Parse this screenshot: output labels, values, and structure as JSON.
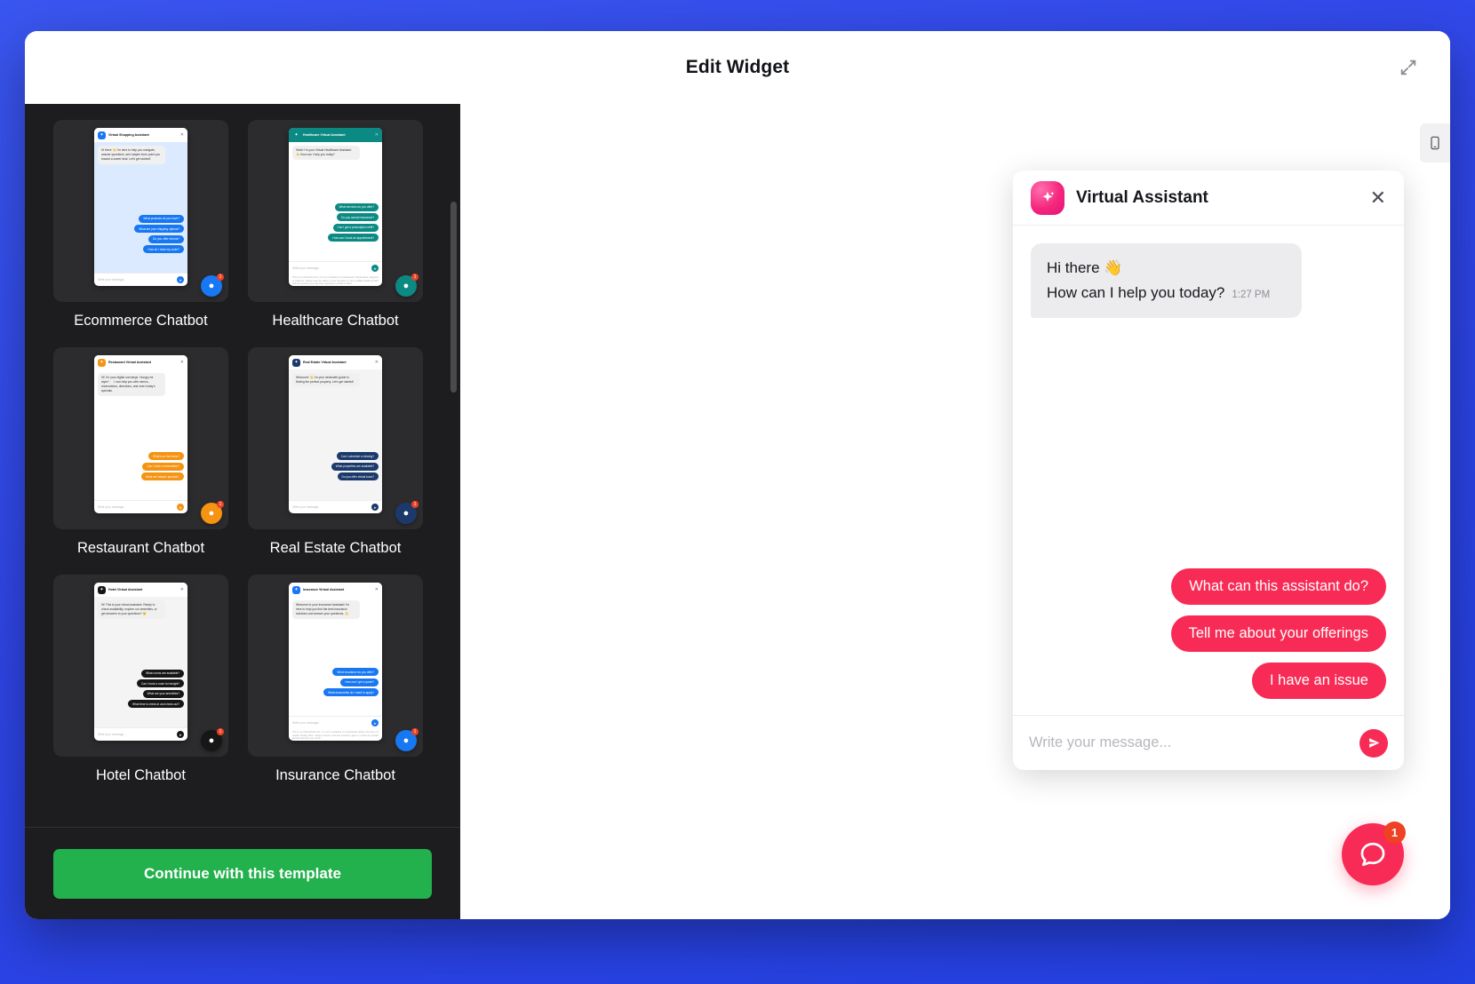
{
  "header": {
    "title": "Edit Widget",
    "expand_icon": "expand-diagonal-icon"
  },
  "sidebar": {
    "scrollbar": "vertical-scrollbar",
    "continue_button": "Continue with this template",
    "templates": [
      {
        "label": "Ecommerce Chatbot",
        "accent": "#1877f2",
        "header_bg": "#ffffff",
        "header_text": "#111111",
        "body_bg": "#dbeafe",
        "assistant_name": "Virtual Shopping Assistant",
        "greeting": "Hi there 👋\nI'm here to help you navigate, answer questions, and maybe even point you toward a sweet deal. Let's get started!",
        "replies": [
          "What products do you have?",
          "What are your shipping options?",
          "Do you offer returns?",
          "How do I track my order?"
        ],
        "input_placeholder": "Write your message...",
        "fab_icon": "chat-icon",
        "badge": "1",
        "disclaimer": ""
      },
      {
        "label": "Healthcare Chatbot",
        "accent": "#0b8a84",
        "header_bg": "#0b8a84",
        "header_text": "#ffffff",
        "body_bg": "#ffffff",
        "assistant_name": "Healthcare Virtual Assistant",
        "greeting": "Hello! I'm your Virtual Healthcare Assistant. 👋\nHow can I help you today?",
        "replies": [
          "What services do you offer?",
          "Do you accept insurance?",
          "Can I get a prescription refill?",
          "How can I book an appointment?"
        ],
        "input_placeholder": "Write your message...",
        "fab_icon": "chat-icon",
        "badge": "1",
        "disclaimer": "This is an informational tool. It is not a substitute for professional medical advice, diagnosis or treatment. Always seek the advice of your physician or other qualified health provider with any questions you may have regarding a medical condition."
      },
      {
        "label": "Restaurant Chatbot",
        "accent": "#f59313",
        "header_bg": "#ffffff",
        "header_text": "#111111",
        "body_bg": "#ffffff",
        "assistant_name": "Restaurant Virtual Assistant",
        "greeting": "Hi! I'm your digital concierge. Hungry for style? 🍽️\nI can help you with menus, reservations, directions, and even today's specials.",
        "replies": [
          "What's on the menu?",
          "Can I book a reservation?",
          "What are today's specials?"
        ],
        "input_placeholder": "Write your message...",
        "fab_icon": "chat-icon",
        "badge": "1",
        "disclaimer": ""
      },
      {
        "label": "Real Estate Chatbot",
        "accent": "#1b3a6b",
        "header_bg": "#ffffff",
        "header_text": "#111111",
        "body_bg": "#f4f4f5",
        "assistant_name": "Real Estate Virtual Assistant",
        "greeting": "Welcome! 👋\nI'm your dedicated guide to finding the perfect property.\nLet's get started!",
        "replies": [
          "Can I schedule a viewing?",
          "What properties are available?",
          "Do you offer virtual tours?"
        ],
        "input_placeholder": "Write your message...",
        "fab_icon": "chat-icon",
        "badge": "1",
        "disclaimer": ""
      },
      {
        "label": "Hotel Chatbot",
        "accent": "#161616",
        "header_bg": "#ffffff",
        "header_text": "#111111",
        "body_bg": "#f4f4f5",
        "assistant_name": "Hotel Virtual Assistant",
        "greeting": "Hi! This is your virtual assistant.\nReady to check availability, explore our amenities, or get answers to your questions? 😊",
        "replies": [
          "What rooms are available?",
          "Can I book a room for tonight?",
          "What are your amenities?",
          "What time is check-in and check-out?"
        ],
        "input_placeholder": "Write your message...",
        "fab_icon": "chat-icon",
        "badge": "1",
        "disclaimer": ""
      },
      {
        "label": "Insurance Chatbot",
        "accent": "#1877f2",
        "header_bg": "#ffffff",
        "header_text": "#111111",
        "body_bg": "#ffffff",
        "assistant_name": "Insurance Virtual Assistant",
        "greeting": "Welcome to your Insurance Assistant!\nI'm here to help you find the best insurance solutions and answer your questions. 👋",
        "replies": [
          "What insurance do you offer?",
          "How can I get a quote?",
          "What documents do I need to apply?"
        ],
        "input_placeholder": "Write your message...",
        "fab_icon": "chat-icon",
        "badge": "1",
        "disclaimer": "This is an informational tool. It is not a substitute for professional advice and does not provide binding offers. Always consult a licensed insurance agent to review the specific policies tailored to your needs."
      }
    ]
  },
  "preview": {
    "device_toggle_icon": "mobile-device-icon",
    "widget": {
      "assistant_name": "Virtual Assistant",
      "avatar_icon": "sparkle-icon",
      "close_icon": "close-icon",
      "accent_color": "#f72b55",
      "messages": [
        {
          "line1": "Hi there 👋",
          "line2": "How can I help you today?",
          "time": "1:27 PM"
        }
      ],
      "quick_replies": [
        "What can this assistant do?",
        "Tell me about your offerings",
        "I have an issue"
      ],
      "input_placeholder": "Write your message...",
      "send_icon": "send-icon"
    },
    "fab": {
      "icon": "chat-bubble-icon",
      "badge": "1",
      "color": "#f72b55"
    }
  }
}
